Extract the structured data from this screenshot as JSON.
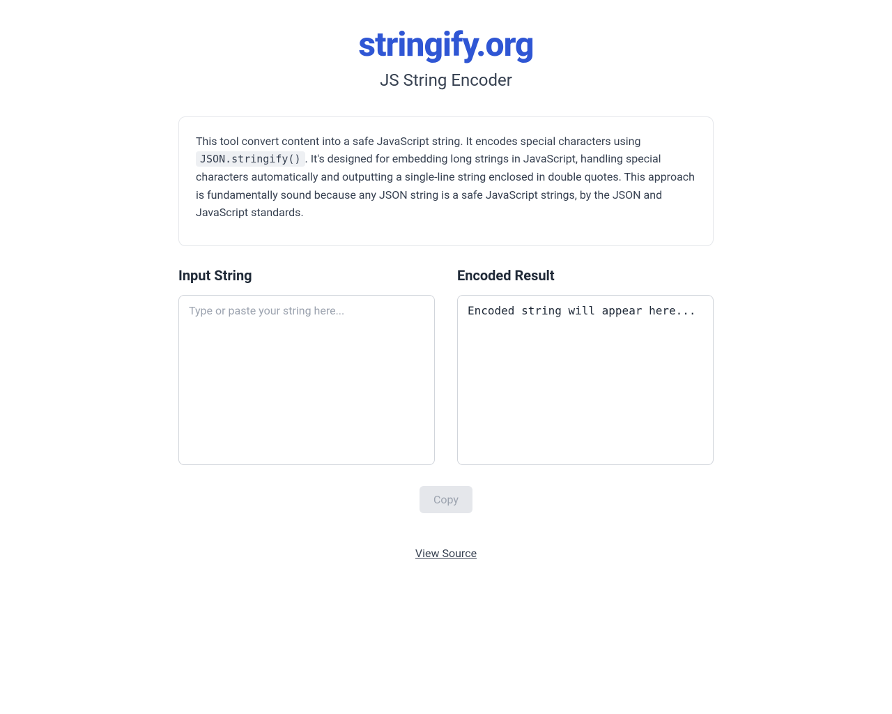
{
  "header": {
    "title": "stringify.org",
    "subtitle": "JS String Encoder"
  },
  "description": {
    "text_before_code": "This tool convert content into a safe JavaScript string. It encodes special characters using ",
    "code": "JSON.stringify()",
    "text_after_code": ". It's designed for embedding long strings in JavaScript, handling special characters automatically and outputting a single-line string enclosed in double quotes. This approach is fundamentally sound because any JSON string is a safe JavaScript strings, by the JSON and JavaScript standards."
  },
  "input_panel": {
    "heading": "Input String",
    "placeholder": "Type or paste your string here...",
    "value": ""
  },
  "output_panel": {
    "heading": "Encoded Result",
    "content": "Encoded string will appear here..."
  },
  "actions": {
    "copy_label": "Copy"
  },
  "footer": {
    "view_source_label": "View Source"
  }
}
